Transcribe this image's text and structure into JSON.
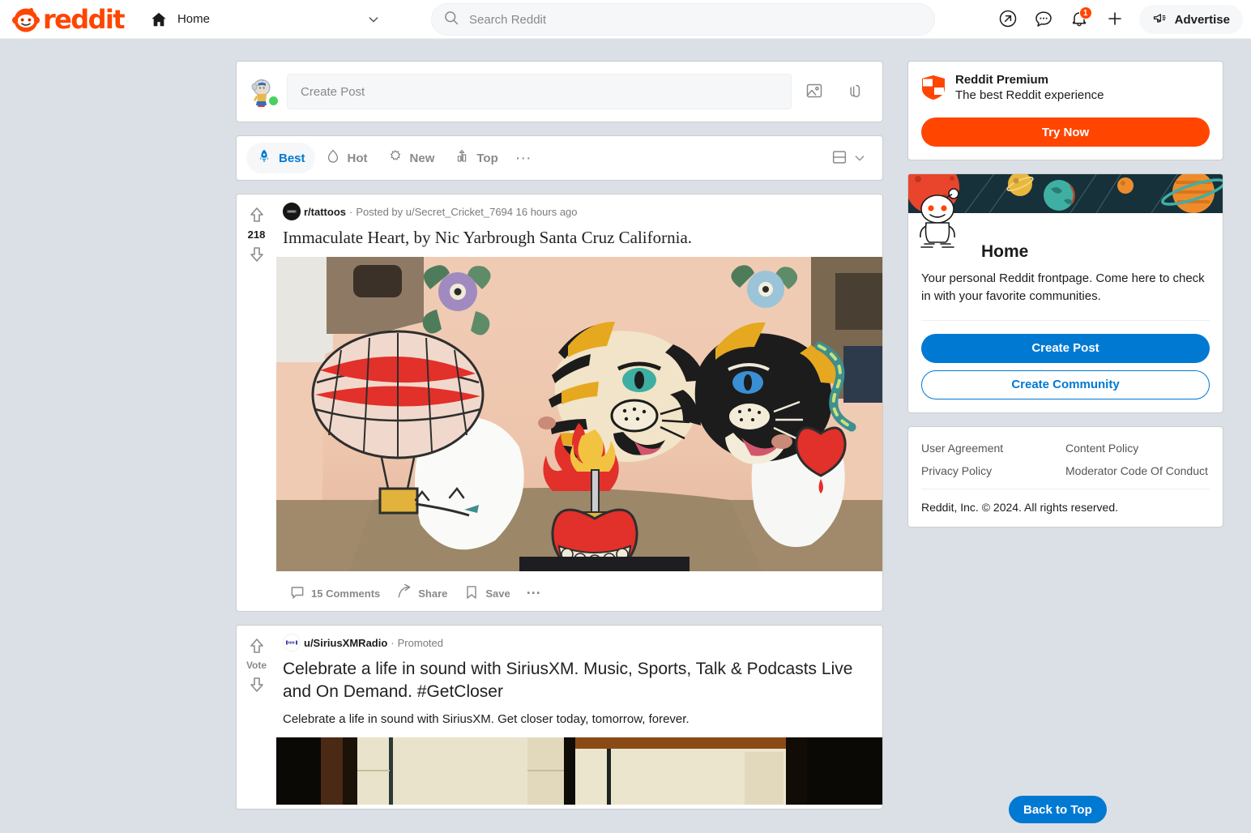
{
  "header": {
    "logo_text": "reddit",
    "home_label": "Home",
    "search_placeholder": "Search Reddit",
    "search_value": "",
    "notification_count": "1",
    "advertise_label": "Advertise",
    "icons": {
      "popular": "arrow-up-right-circle-icon",
      "chat": "chat-bubble-icon",
      "notifications": "bell-icon",
      "create": "plus-icon",
      "advertise": "megaphone-icon",
      "home": "home-icon",
      "chevron": "chevron-down-icon",
      "search": "search-icon"
    }
  },
  "create_post": {
    "placeholder": "Create Post",
    "value": "",
    "image_button": "image-icon",
    "link_button": "link-icon",
    "avatar": "user-avatar-astronaut",
    "status": "online"
  },
  "sort_bar": {
    "items": [
      {
        "label": "Best",
        "icon": "rocket-icon",
        "active": true
      },
      {
        "label": "Hot",
        "icon": "flame-icon",
        "active": false
      },
      {
        "label": "New",
        "icon": "sparkle-icon",
        "active": false
      },
      {
        "label": "Top",
        "icon": "chart-icon",
        "active": false
      }
    ],
    "more_label": "···",
    "view_icon": "card-view-icon",
    "view_chevron": "chevron-down-icon"
  },
  "posts": [
    {
      "subreddit": "r/tattoos",
      "meta_separator": "·",
      "posted_by": "Posted by u/Secret_Cricket_7694 16 hours ago",
      "title": "Immaculate Heart, by Nic Yarbrough Santa Cruz California.",
      "score": "218",
      "comments_label": "15 Comments",
      "share_label": "Share",
      "save_label": "Save",
      "more_label": "···",
      "promoted": false
    },
    {
      "subreddit": "u/SiriusXMRadio",
      "meta_separator": "·",
      "posted_by": "Promoted",
      "title": "Celebrate a life in sound with SiriusXM. Music, Sports, Talk & Podcasts Live and On Demand. #GetCloser",
      "description": "Celebrate a life in sound with SiriusXM. Get closer today, tomorrow, forever.",
      "vote_label": "Vote",
      "promoted": true
    }
  ],
  "sidebar": {
    "premium": {
      "title": "Reddit Premium",
      "subtitle": "The best Reddit experience",
      "cta": "Try Now",
      "icon": "premium-shield-icon"
    },
    "home_card": {
      "name": "Home",
      "description": "Your personal Reddit frontpage. Come here to check in with your favorite communities.",
      "create_post": "Create Post",
      "create_community": "Create Community",
      "snoo": "snoo-mascot-icon",
      "banner": "space-planets-banner"
    },
    "footer": {
      "links": [
        "User Agreement",
        "Content Policy",
        "Privacy Policy",
        "Moderator Code Of Conduct"
      ],
      "copyright": "Reddit, Inc. © 2024. All rights reserved."
    }
  },
  "back_to_top": "Back to Top",
  "colors": {
    "brand_orange": "#FF4500",
    "brand_blue": "#0079D3",
    "page_bg": "#DAE0E6",
    "card_bg": "#FFFFFF",
    "muted_text": "#878A8C",
    "online_green": "#46D160"
  }
}
